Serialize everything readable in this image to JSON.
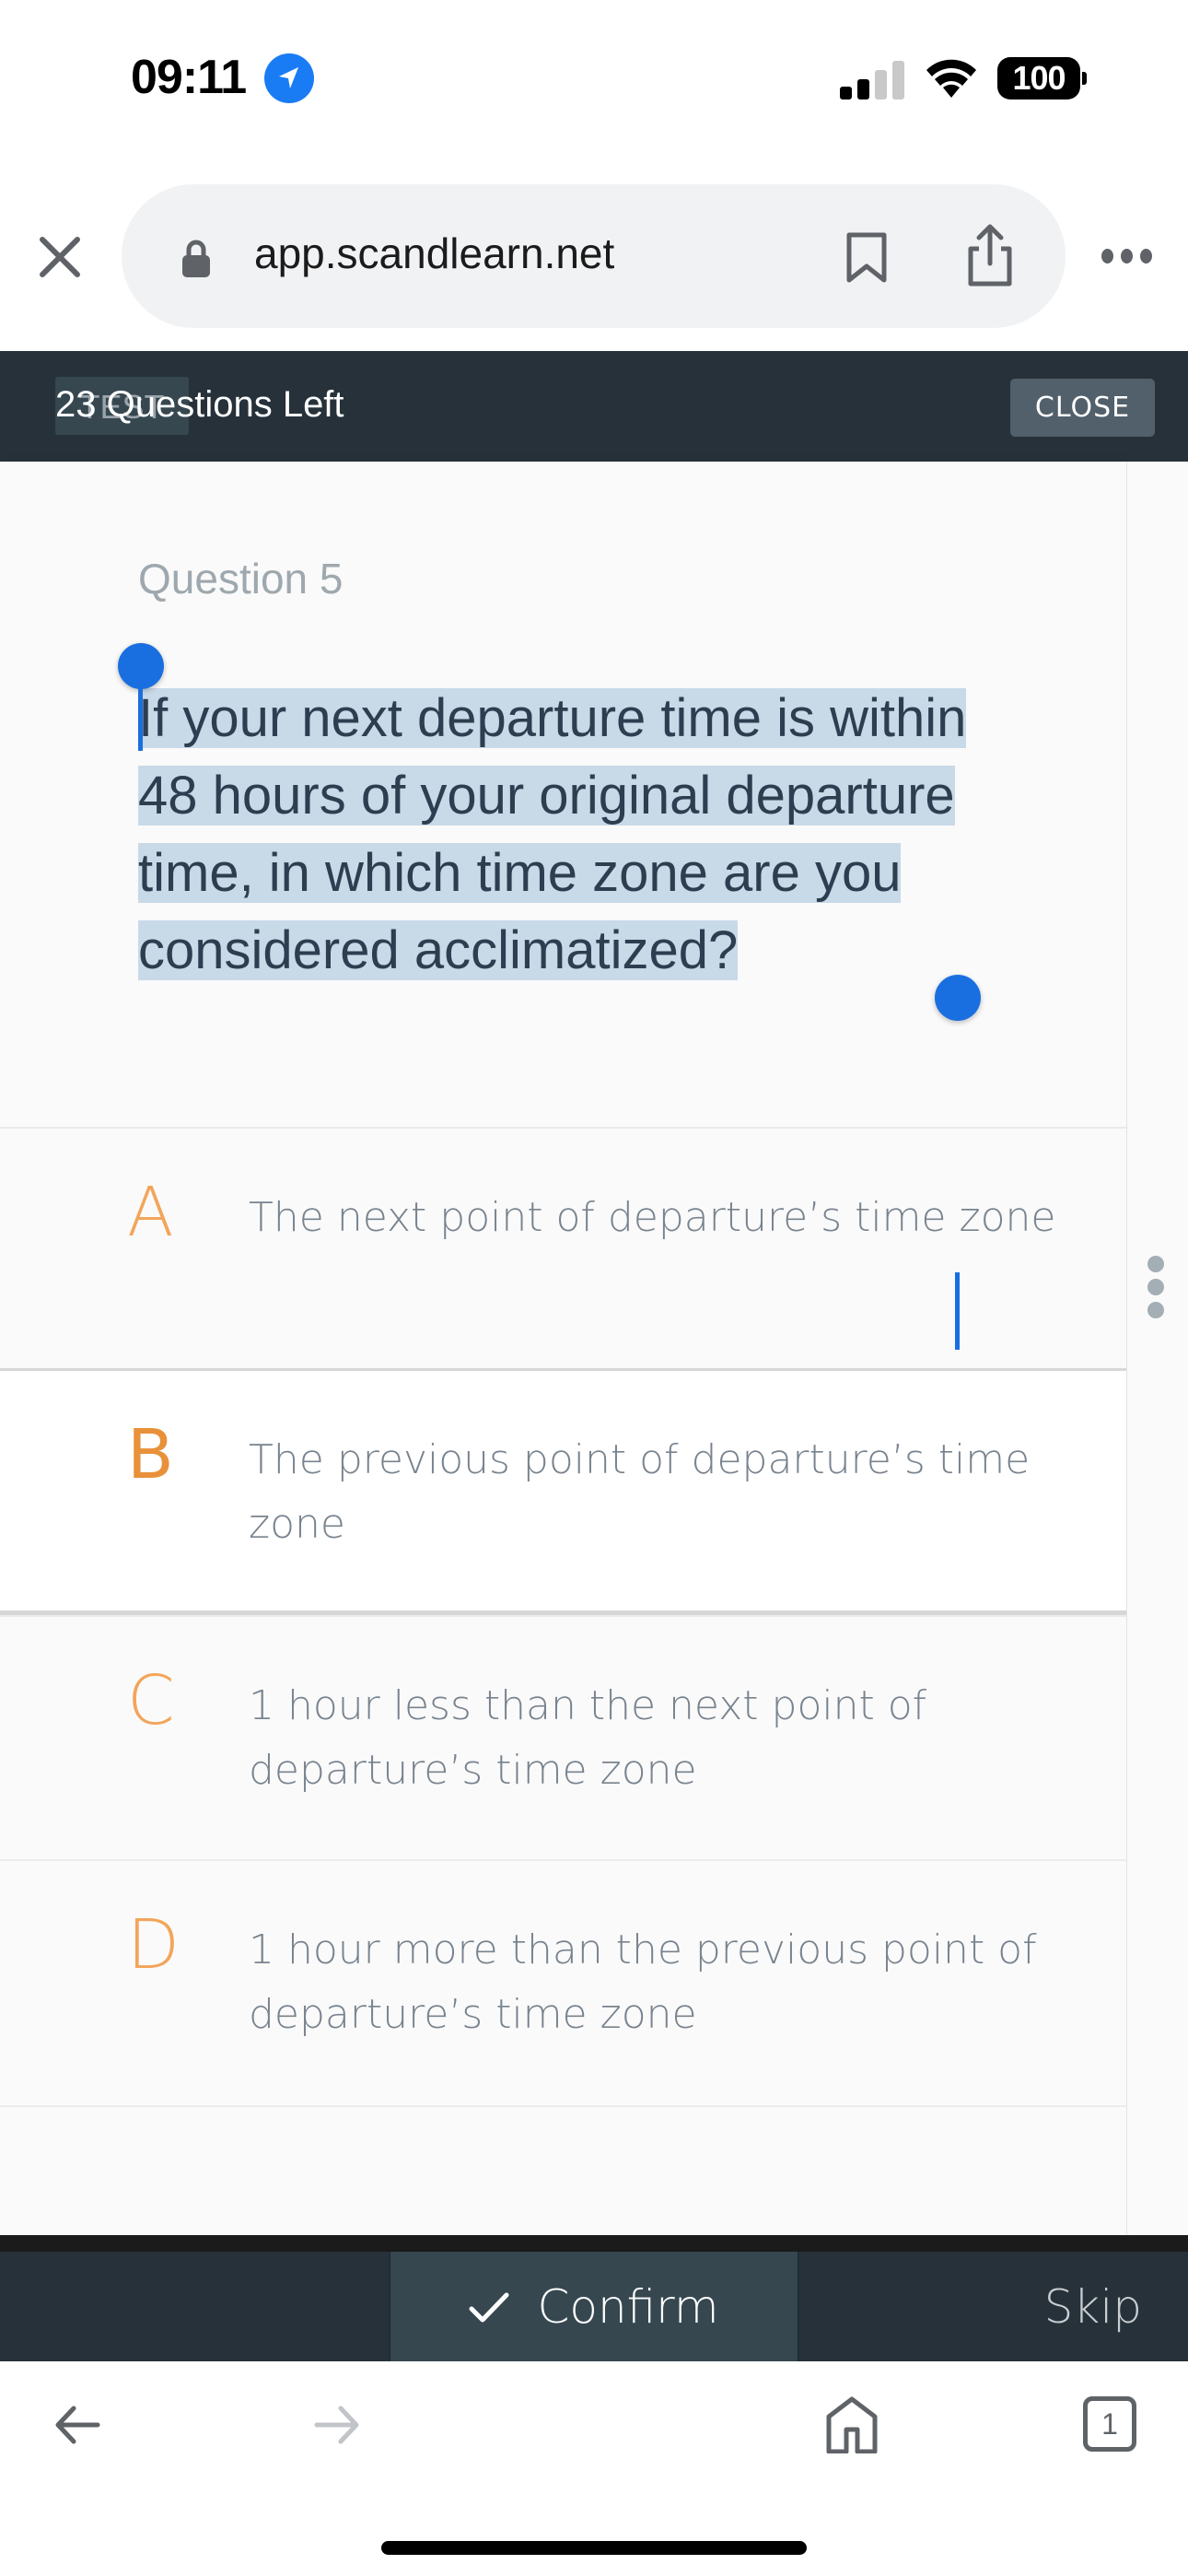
{
  "status_bar": {
    "time": "09:11",
    "location_icon": "location-arrow-icon",
    "signal_icon": "cellular-signal-icon",
    "wifi_icon": "wifi-icon",
    "battery": "100"
  },
  "browser": {
    "close_icon": "close-icon",
    "lock_icon": "lock-icon",
    "url": "app.scandlearn.net",
    "bookmark_icon": "bookmark-icon",
    "share_icon": "share-icon",
    "more_icon": "more-horizontal-icon"
  },
  "quiz_header": {
    "badge": "TEST",
    "questions_left": "23 Questions Left",
    "close_label": "CLOSE"
  },
  "question": {
    "number_label": "Question 5",
    "text": "If your next departure time is within 48 hours of your original departure time, in which time zone are you considered acclimatized?",
    "text_selected": true
  },
  "options": [
    {
      "letter": "A",
      "text": "The next point of departure’s time zone",
      "selected": false
    },
    {
      "letter": "B",
      "text": "The previous point of departure’s time zone",
      "selected": true
    },
    {
      "letter": "C",
      "text": "1 hour less than the next point of departure’s time zone",
      "selected": false
    },
    {
      "letter": "D",
      "text": "1 hour more than the previous point of departure’s time zone",
      "selected": false
    }
  ],
  "side_drawer": {
    "handle_icon": "more-vertical-icon"
  },
  "actions": {
    "confirm_icon": "check-icon",
    "confirm_label": "Confirm",
    "skip_label": "Skip"
  },
  "toolbar": {
    "back_icon": "arrow-left-icon",
    "forward_icon": "arrow-right-icon",
    "forward_enabled": false,
    "home_icon": "home-icon",
    "tab_count": "1"
  },
  "colors": {
    "header_bg": "#263139",
    "accent_letter": "#f2a55a",
    "accent_letter_selected": "#e8913a",
    "selection_highlight": "#c8d9e8",
    "selection_handle": "#1a6fe0",
    "question_text": "#2c3e50",
    "option_text": "#78838e"
  }
}
